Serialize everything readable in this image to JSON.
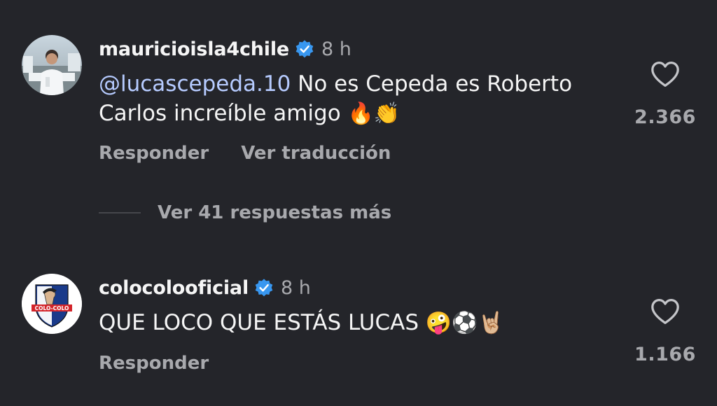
{
  "comments": [
    {
      "username": "mauricioisla4chile",
      "time": "8 h",
      "mention": "@lucascepeda.10",
      "text": " No es Cepeda es Roberto Carlos increíble amigo ",
      "emojis": "🔥👏",
      "reply_label": "Responder",
      "translate_label": "Ver traducción",
      "likes": "2.366",
      "avatar_icon": "profile-photo-man"
    },
    {
      "username": "colocolooficial",
      "time": "8 h",
      "text": "QUE LOCO QUE ESTÁS LUCAS ",
      "emojis": "🤪⚽🤘🏼",
      "reply_label": "Responder",
      "likes": "1.166",
      "avatar_icon": "colo-colo-crest",
      "crest_text": "COLO-COLO"
    }
  ],
  "more_replies": "Ver 41 respuestas más",
  "colors": {
    "background": "#24252a",
    "mention": "#b6cbff",
    "verified": "#3897f0",
    "secondary_text": "#a8a9ad"
  }
}
